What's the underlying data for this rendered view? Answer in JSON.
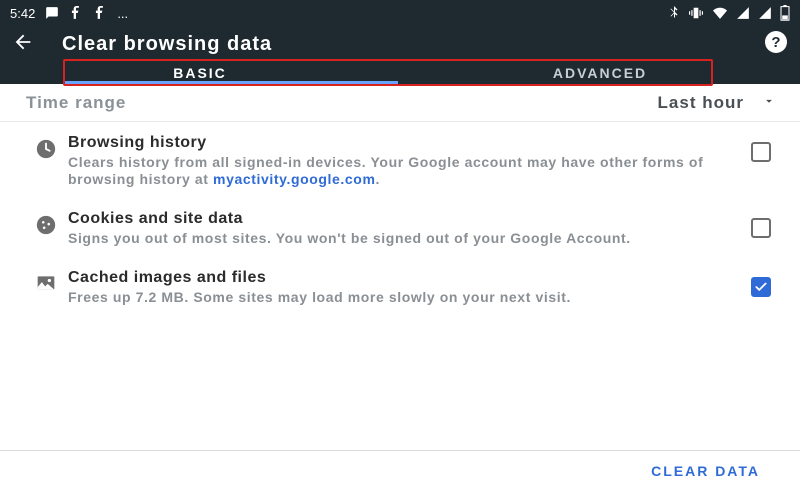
{
  "status_bar": {
    "time": "5:42",
    "left_more": "..."
  },
  "app_bar": {
    "title": "Clear browsing data"
  },
  "tabs": {
    "basic": "BASIC",
    "advanced": "ADVANCED"
  },
  "time_range": {
    "label": "Time range",
    "value": "Last hour"
  },
  "items": {
    "browsing_history": {
      "title": "Browsing history",
      "desc_prefix": "Clears history from all signed-in devices. Your Google account may have other forms of browsing history at ",
      "link_text": "myactivity.google.com",
      "desc_suffix": "."
    },
    "cookies": {
      "title": "Cookies and site data",
      "desc": "Signs you out of most sites. You won't be signed out of your Google Account."
    },
    "cache": {
      "title": "Cached images and files",
      "desc": "Frees up 7.2 MB. Some sites may load more slowly on your next visit."
    }
  },
  "footer": {
    "clear": "CLEAR DATA"
  }
}
